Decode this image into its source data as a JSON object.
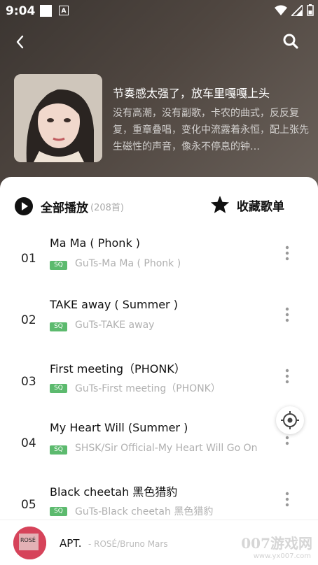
{
  "status": {
    "time": "9:04",
    "a_badge": "A"
  },
  "playlist": {
    "title": "节奏感太强了，放车里嘎嘎上头",
    "description": "没有高潮，没有副歌，卡农的曲式，反反复复，重章叠唱，变化中流露着永恒，配上张先生磁性的声音，像永不停息的钟…"
  },
  "actions": {
    "play_all": "全部播放",
    "count": "(208首)",
    "favorite": "收藏歌单"
  },
  "songs": [
    {
      "num": "01",
      "title": "Ma Ma ( Phonk )",
      "badge": "SQ",
      "artist": "GuTs-Ma Ma ( Phonk )"
    },
    {
      "num": "02",
      "title": "TAKE away ( Summer )",
      "badge": "SQ",
      "artist": "GuTs-TAKE away"
    },
    {
      "num": "03",
      "title": "First meeting（PHONK）",
      "badge": "SQ",
      "artist": "GuTs-First meeting（PHONK）"
    },
    {
      "num": "04",
      "title": "My Heart Will (Summer )",
      "badge": "SQ",
      "artist": "SHSK/Sir Official-My Heart Will Go On"
    },
    {
      "num": "05",
      "title": "Black cheetah 黑色猎豹",
      "badge": "SQ",
      "artist": "GuTs-Black cheetah 黑色猎豹"
    }
  ],
  "mini_player": {
    "title": "APT.",
    "artist": "- ROSÉ/Bruno Mars",
    "cover_text": "ROSÉ"
  },
  "watermark": {
    "main": "007游戏网",
    "sub": "www.yx007.com"
  },
  "colors": {
    "sq_badge": "#5cba6e",
    "hero_bg": "#4f4640"
  }
}
